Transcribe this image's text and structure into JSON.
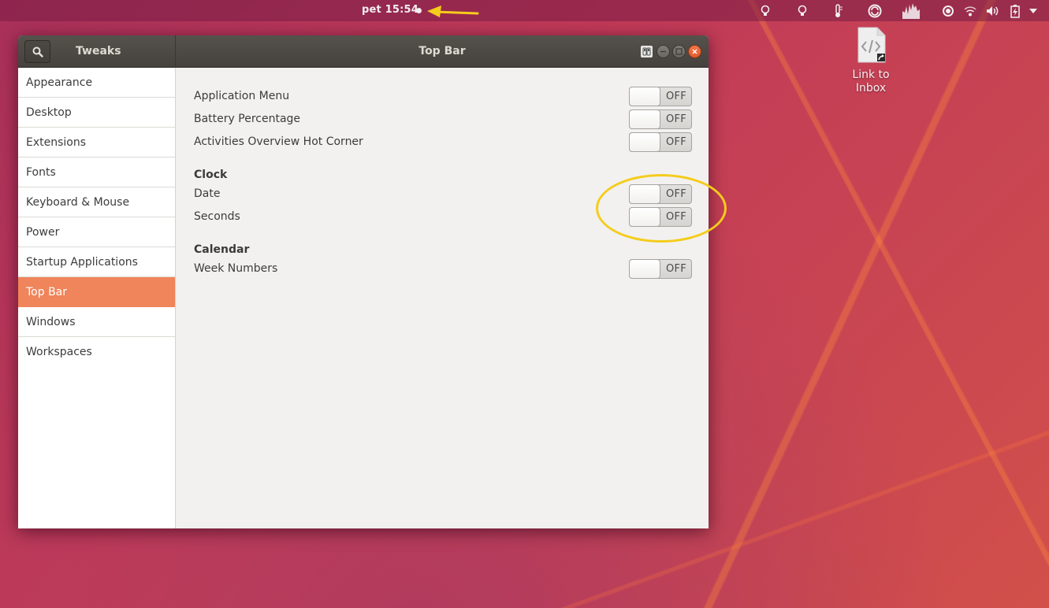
{
  "topbar": {
    "clock": "pet 15:54",
    "tray_icons": [
      "lightbulb-icon",
      "lightbulb-icon",
      "thermometer-icon",
      "sync-icon",
      "cpu-graph-icon",
      "location-icon",
      "wifi-icon",
      "volume-icon",
      "battery-charging-icon",
      "system-menu-arrow-icon"
    ]
  },
  "window": {
    "app_title": "Tweaks",
    "page_title": "Top Bar",
    "controls": [
      "keep-on-top",
      "minimize",
      "maximize",
      "close"
    ]
  },
  "sidebar": {
    "items": [
      {
        "label": "Appearance",
        "active": false
      },
      {
        "label": "Desktop",
        "active": false
      },
      {
        "label": "Extensions",
        "active": false
      },
      {
        "label": "Fonts",
        "active": false
      },
      {
        "label": "Keyboard & Mouse",
        "active": false
      },
      {
        "label": "Power",
        "active": false
      },
      {
        "label": "Startup Applications",
        "active": false
      },
      {
        "label": "Top Bar",
        "active": true
      },
      {
        "label": "Windows",
        "active": false
      },
      {
        "label": "Workspaces",
        "active": false
      }
    ]
  },
  "content": {
    "general": [
      {
        "label": "Application Menu",
        "state": "OFF"
      },
      {
        "label": "Battery Percentage",
        "state": "OFF"
      },
      {
        "label": "Activities Overview Hot Corner",
        "state": "OFF"
      }
    ],
    "clock_section": {
      "title": "Clock",
      "rows": [
        {
          "label": "Date",
          "state": "OFF"
        },
        {
          "label": "Seconds",
          "state": "OFF"
        }
      ]
    },
    "calendar_section": {
      "title": "Calendar",
      "rows": [
        {
          "label": "Week Numbers",
          "state": "OFF"
        }
      ]
    }
  },
  "desktop": {
    "icon_label_line1": "Link to",
    "icon_label_line2": "Inbox"
  },
  "colors": {
    "accent": "#f0845a",
    "annotation": "#f5cc1c",
    "close_button": "#e95420"
  }
}
